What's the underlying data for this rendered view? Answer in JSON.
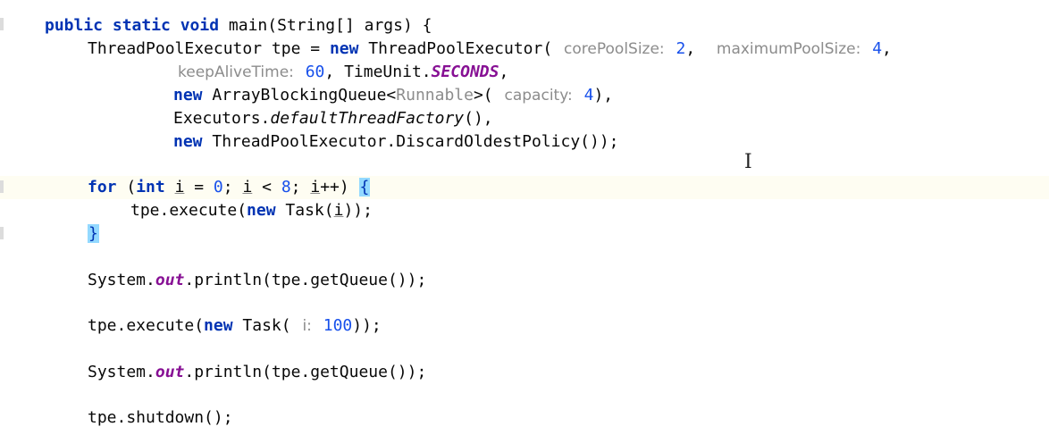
{
  "editor": {
    "language": "Java",
    "colors": {
      "keyword": "#0033b3",
      "number": "#1750eb",
      "static_field": "#871094",
      "hint": "#8c8c8c",
      "brace_match_bg": "#93d9ff",
      "current_line_bg": "#fefdf2"
    },
    "cursor_icon": "text-cursor-icon",
    "lines": {
      "l1": {
        "kw1": "public static void",
        "rest": " main(String[] args) {"
      },
      "l2": {
        "lead": "ThreadPoolExecutor tpe = ",
        "kw": "new",
        "call": " ThreadPoolExecutor(",
        "hint1": "corePoolSize:",
        "v1": "2",
        "sep1": ",",
        "hint2": "maximumPoolSize:",
        "v2": "4",
        "sep2": ","
      },
      "l3": {
        "hint": "keepAliveTime:",
        "v": "60",
        "mid": ", TimeUnit.",
        "field": "SECONDS",
        "end": ","
      },
      "l4": {
        "kw": "new",
        "a": " ArrayBlockingQueue<",
        "generic": "Runnable",
        "b": ">(",
        "hint": "capacity:",
        "v": "4",
        "end": "),"
      },
      "l5": {
        "a": "Executors.",
        "method": "defaultThreadFactory",
        "end": "(),"
      },
      "l6": {
        "kw": "new",
        "rest": " ThreadPoolExecutor.DiscardOldestPolicy());"
      },
      "l7": {
        "kw1": "for",
        "p1": " (",
        "kw2": "int",
        "sp": " ",
        "i1": "i",
        "p2": " = ",
        "v0": "0",
        "p3": "; ",
        "i2": "i",
        "p4": " < ",
        "v8": "8",
        "p5": "; ",
        "i3": "i",
        "p6": "++) ",
        "brace": "{"
      },
      "l8": {
        "a": "tpe.execute(",
        "kw": "new",
        "b": " Task(",
        "i": "i",
        "end": "));"
      },
      "l9": {
        "brace": "}"
      },
      "l10": {
        "a": "System.",
        "field": "out",
        "b": ".println(tpe.getQueue());"
      },
      "l11": {
        "a": "tpe.execute(",
        "kw": "new",
        "b": " Task(",
        "hint": "i:",
        "v": "100",
        "end": "));"
      },
      "l12": {
        "a": "System.",
        "field": "out",
        "b": ".println(tpe.getQueue());"
      },
      "l13": {
        "a": "tpe.shutdown();"
      }
    }
  }
}
